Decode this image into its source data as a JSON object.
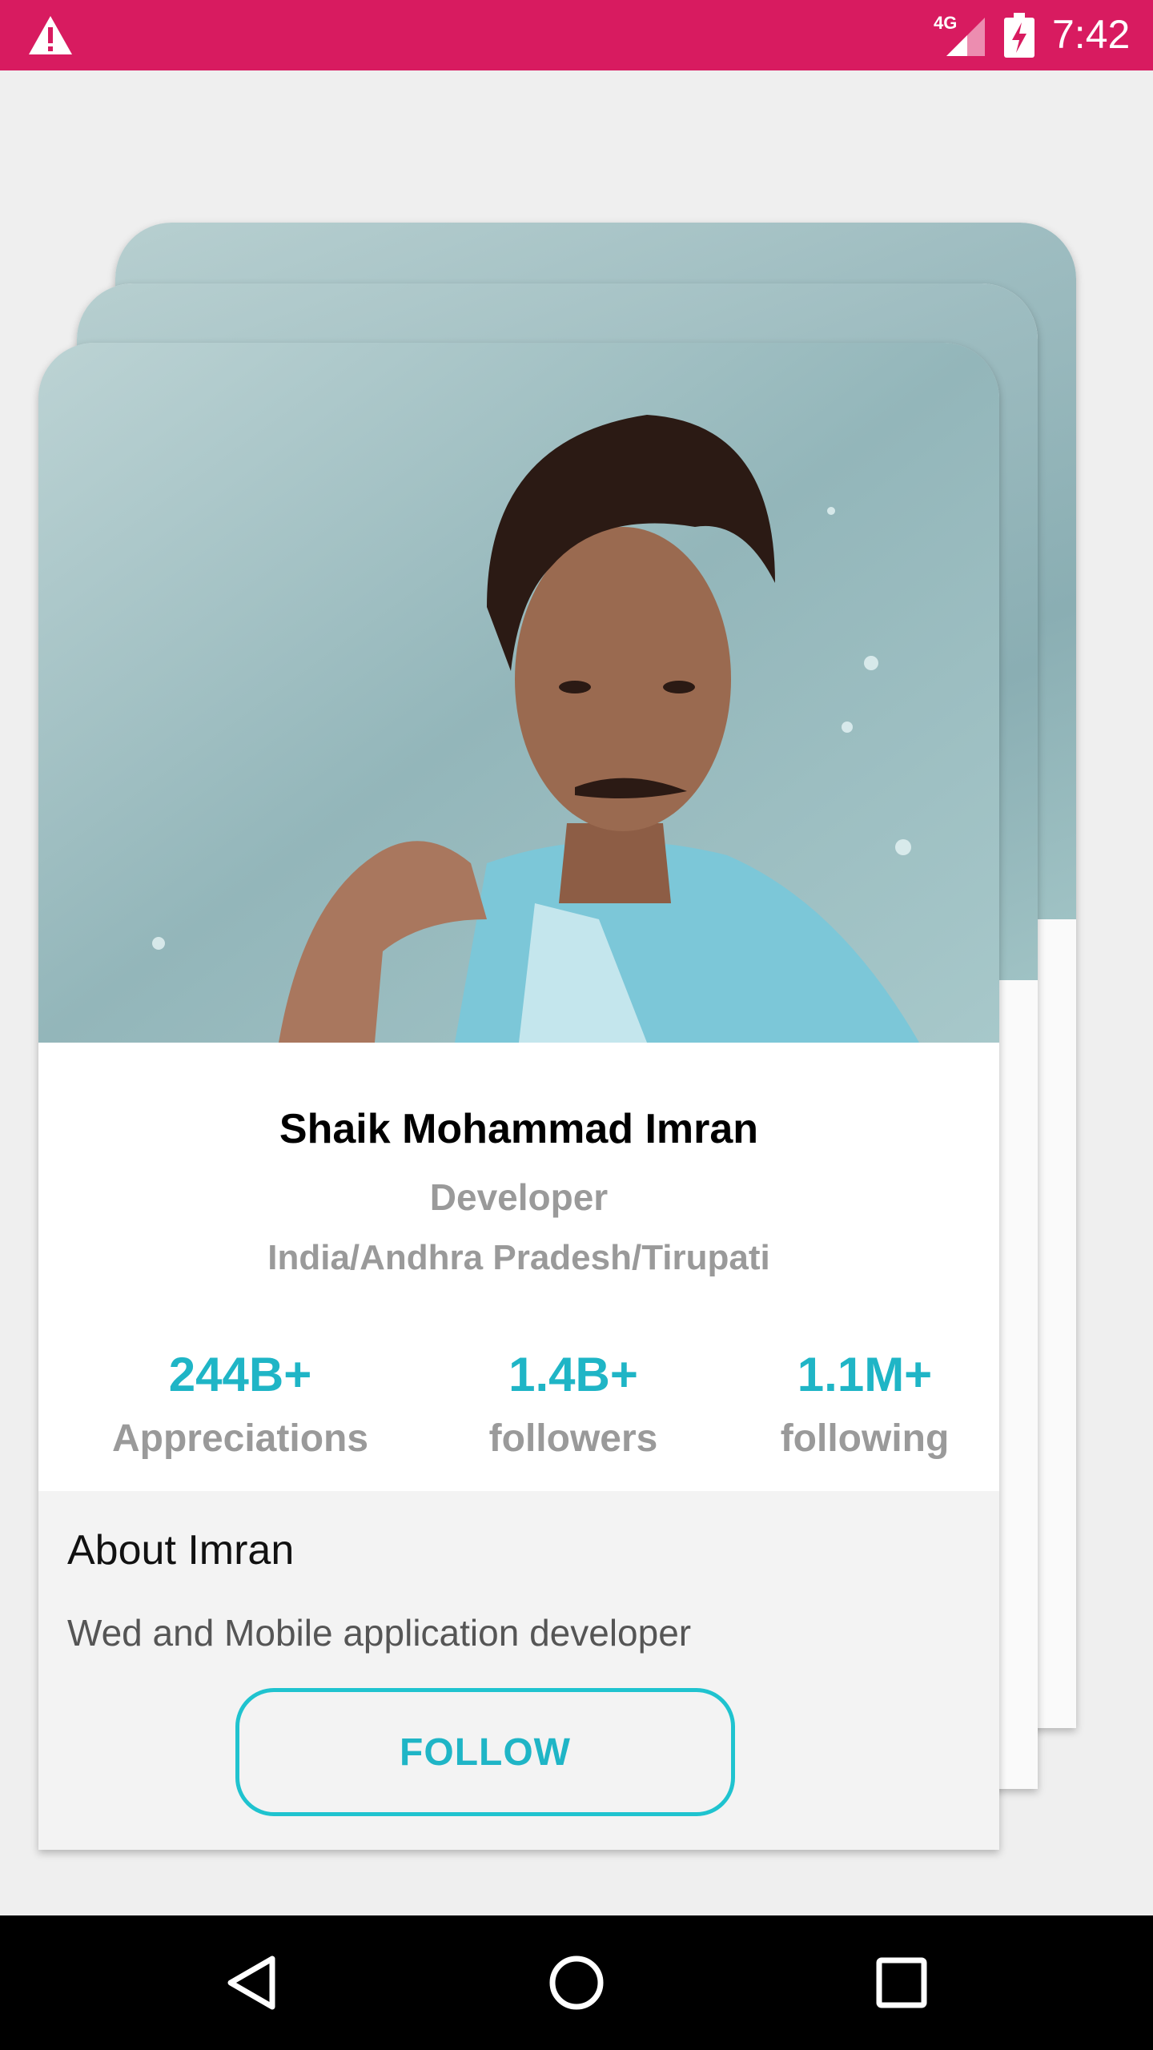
{
  "status_bar": {
    "network": "4G",
    "time": "7:42",
    "background_color": "#d81b60"
  },
  "profile": {
    "name": "Shaik Mohammad Imran",
    "role": "Developer",
    "location": "India/Andhra Pradesh/Tirupati",
    "stats": [
      {
        "value": "244B+",
        "label": "Appreciations"
      },
      {
        "value": "1.4B+",
        "label": "followers"
      },
      {
        "value": "1.1M+",
        "label": "following"
      }
    ],
    "about_title": "About Imran",
    "about_text": "Wed and Mobile application developer",
    "follow_label": "FOLLOW",
    "accent_color": "#1fb5c6"
  },
  "icons": {
    "status": [
      "warning-icon",
      "signal-icon",
      "battery-charging-icon"
    ],
    "nav": [
      "back-icon",
      "home-icon",
      "recents-icon"
    ]
  }
}
